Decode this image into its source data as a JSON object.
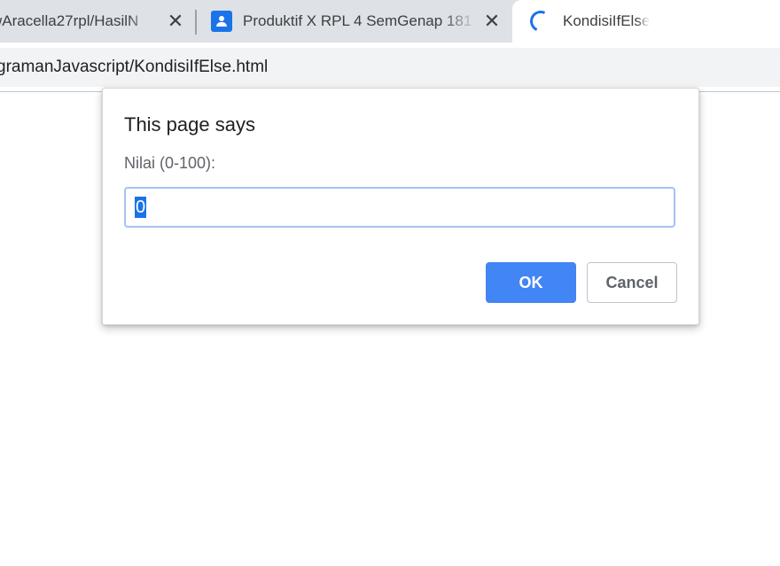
{
  "tabs": [
    {
      "title": "wAracella27rpl/HasilN",
      "close_icon": "close-icon"
    },
    {
      "title": "Produktif X RPL 4 SemGenap 181",
      "favicon": "classroom-icon",
      "close_icon": "close-icon"
    },
    {
      "title": "KondisiIfElse",
      "favicon": "loading-spinner-icon",
      "active": true
    }
  ],
  "toolbar": {
    "url": "gramanJavascript/KondisiIfElse.html"
  },
  "dialog": {
    "title": "This page says",
    "message": "Nilai (0-100):",
    "input_value": "0",
    "ok_label": "OK",
    "cancel_label": "Cancel"
  },
  "colors": {
    "tabstrip": "#dee1e6",
    "accent": "#4285f4",
    "selection": "#1a73e8"
  }
}
